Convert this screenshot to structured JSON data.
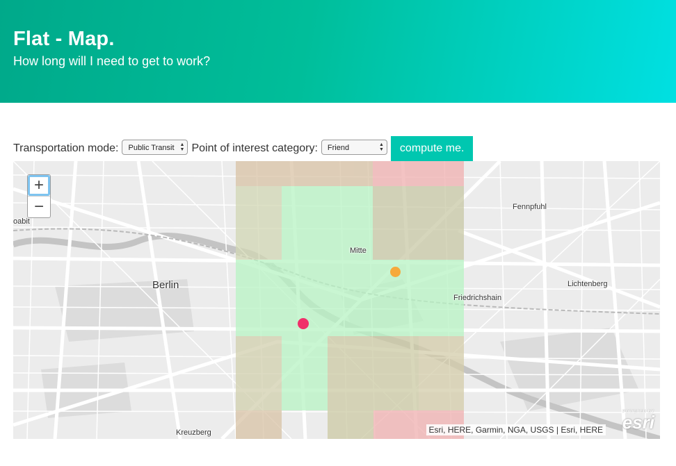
{
  "header": {
    "title": "Flat - Map.",
    "subtitle": "How long will I need to get to work?"
  },
  "controls": {
    "transport_label": "Transportation mode:",
    "transport_value": "Public Transit",
    "poi_label": "Point of interest category:",
    "poi_value": "Friend",
    "compute_label": "compute me."
  },
  "map": {
    "zoom_in": "+",
    "zoom_out": "−",
    "places": {
      "moabit": "oabit",
      "fennpfuhl": "Fennpfuhl",
      "mitte": "Mitte",
      "berlin": "Berlin",
      "lichtenberg": "Lichtenberg",
      "friedrichshain": "Friedrichshain",
      "kreuzberg": "Kreuzberg"
    },
    "attribution": "Esri, HERE, Garmin, NGA, USGS | Esri, HERE",
    "logo_powered": "POWERED BY",
    "logo_text": "esri",
    "marker_colors": {
      "home": "#f0306a",
      "poi": "#f6a93b"
    },
    "overlay_colors": {
      "near": "#b3f2c0",
      "mid": "#c9d0a8",
      "far": "#e7b3b3"
    }
  }
}
